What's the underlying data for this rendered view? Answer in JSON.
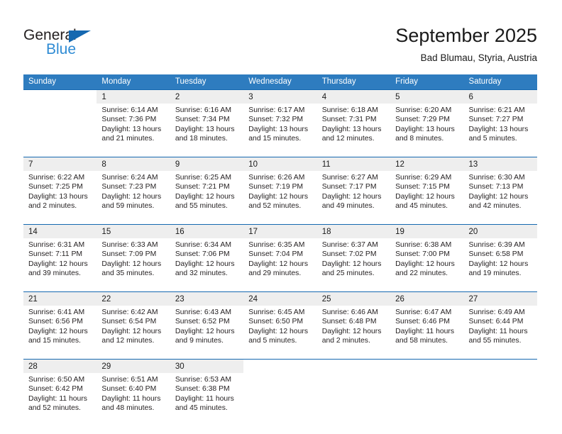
{
  "brand": {
    "name_part1": "General",
    "name_part2": "Blue",
    "triangle_color": "#1568b0",
    "blue_color": "#2e8bd4"
  },
  "header": {
    "title": "September 2025",
    "subtitle": "Bad Blumau, Styria, Austria"
  },
  "theme": {
    "header_row_bg": "#2e7cbf",
    "day_number_bg": "#eeeeee",
    "row_divider": "#1568b0"
  },
  "calendar": {
    "weekday_headers": [
      "Sunday",
      "Monday",
      "Tuesday",
      "Wednesday",
      "Thursday",
      "Friday",
      "Saturday"
    ],
    "weeks": [
      {
        "days": [
          {
            "num": "",
            "sunrise": "",
            "sunset": "",
            "daylight1": "",
            "daylight2": ""
          },
          {
            "num": "1",
            "sunrise": "Sunrise: 6:14 AM",
            "sunset": "Sunset: 7:36 PM",
            "daylight1": "Daylight: 13 hours",
            "daylight2": "and 21 minutes."
          },
          {
            "num": "2",
            "sunrise": "Sunrise: 6:16 AM",
            "sunset": "Sunset: 7:34 PM",
            "daylight1": "Daylight: 13 hours",
            "daylight2": "and 18 minutes."
          },
          {
            "num": "3",
            "sunrise": "Sunrise: 6:17 AM",
            "sunset": "Sunset: 7:32 PM",
            "daylight1": "Daylight: 13 hours",
            "daylight2": "and 15 minutes."
          },
          {
            "num": "4",
            "sunrise": "Sunrise: 6:18 AM",
            "sunset": "Sunset: 7:31 PM",
            "daylight1": "Daylight: 13 hours",
            "daylight2": "and 12 minutes."
          },
          {
            "num": "5",
            "sunrise": "Sunrise: 6:20 AM",
            "sunset": "Sunset: 7:29 PM",
            "daylight1": "Daylight: 13 hours",
            "daylight2": "and 8 minutes."
          },
          {
            "num": "6",
            "sunrise": "Sunrise: 6:21 AM",
            "sunset": "Sunset: 7:27 PM",
            "daylight1": "Daylight: 13 hours",
            "daylight2": "and 5 minutes."
          }
        ]
      },
      {
        "days": [
          {
            "num": "7",
            "sunrise": "Sunrise: 6:22 AM",
            "sunset": "Sunset: 7:25 PM",
            "daylight1": "Daylight: 13 hours",
            "daylight2": "and 2 minutes."
          },
          {
            "num": "8",
            "sunrise": "Sunrise: 6:24 AM",
            "sunset": "Sunset: 7:23 PM",
            "daylight1": "Daylight: 12 hours",
            "daylight2": "and 59 minutes."
          },
          {
            "num": "9",
            "sunrise": "Sunrise: 6:25 AM",
            "sunset": "Sunset: 7:21 PM",
            "daylight1": "Daylight: 12 hours",
            "daylight2": "and 55 minutes."
          },
          {
            "num": "10",
            "sunrise": "Sunrise: 6:26 AM",
            "sunset": "Sunset: 7:19 PM",
            "daylight1": "Daylight: 12 hours",
            "daylight2": "and 52 minutes."
          },
          {
            "num": "11",
            "sunrise": "Sunrise: 6:27 AM",
            "sunset": "Sunset: 7:17 PM",
            "daylight1": "Daylight: 12 hours",
            "daylight2": "and 49 minutes."
          },
          {
            "num": "12",
            "sunrise": "Sunrise: 6:29 AM",
            "sunset": "Sunset: 7:15 PM",
            "daylight1": "Daylight: 12 hours",
            "daylight2": "and 45 minutes."
          },
          {
            "num": "13",
            "sunrise": "Sunrise: 6:30 AM",
            "sunset": "Sunset: 7:13 PM",
            "daylight1": "Daylight: 12 hours",
            "daylight2": "and 42 minutes."
          }
        ]
      },
      {
        "days": [
          {
            "num": "14",
            "sunrise": "Sunrise: 6:31 AM",
            "sunset": "Sunset: 7:11 PM",
            "daylight1": "Daylight: 12 hours",
            "daylight2": "and 39 minutes."
          },
          {
            "num": "15",
            "sunrise": "Sunrise: 6:33 AM",
            "sunset": "Sunset: 7:09 PM",
            "daylight1": "Daylight: 12 hours",
            "daylight2": "and 35 minutes."
          },
          {
            "num": "16",
            "sunrise": "Sunrise: 6:34 AM",
            "sunset": "Sunset: 7:06 PM",
            "daylight1": "Daylight: 12 hours",
            "daylight2": "and 32 minutes."
          },
          {
            "num": "17",
            "sunrise": "Sunrise: 6:35 AM",
            "sunset": "Sunset: 7:04 PM",
            "daylight1": "Daylight: 12 hours",
            "daylight2": "and 29 minutes."
          },
          {
            "num": "18",
            "sunrise": "Sunrise: 6:37 AM",
            "sunset": "Sunset: 7:02 PM",
            "daylight1": "Daylight: 12 hours",
            "daylight2": "and 25 minutes."
          },
          {
            "num": "19",
            "sunrise": "Sunrise: 6:38 AM",
            "sunset": "Sunset: 7:00 PM",
            "daylight1": "Daylight: 12 hours",
            "daylight2": "and 22 minutes."
          },
          {
            "num": "20",
            "sunrise": "Sunrise: 6:39 AM",
            "sunset": "Sunset: 6:58 PM",
            "daylight1": "Daylight: 12 hours",
            "daylight2": "and 19 minutes."
          }
        ]
      },
      {
        "days": [
          {
            "num": "21",
            "sunrise": "Sunrise: 6:41 AM",
            "sunset": "Sunset: 6:56 PM",
            "daylight1": "Daylight: 12 hours",
            "daylight2": "and 15 minutes."
          },
          {
            "num": "22",
            "sunrise": "Sunrise: 6:42 AM",
            "sunset": "Sunset: 6:54 PM",
            "daylight1": "Daylight: 12 hours",
            "daylight2": "and 12 minutes."
          },
          {
            "num": "23",
            "sunrise": "Sunrise: 6:43 AM",
            "sunset": "Sunset: 6:52 PM",
            "daylight1": "Daylight: 12 hours",
            "daylight2": "and 9 minutes."
          },
          {
            "num": "24",
            "sunrise": "Sunrise: 6:45 AM",
            "sunset": "Sunset: 6:50 PM",
            "daylight1": "Daylight: 12 hours",
            "daylight2": "and 5 minutes."
          },
          {
            "num": "25",
            "sunrise": "Sunrise: 6:46 AM",
            "sunset": "Sunset: 6:48 PM",
            "daylight1": "Daylight: 12 hours",
            "daylight2": "and 2 minutes."
          },
          {
            "num": "26",
            "sunrise": "Sunrise: 6:47 AM",
            "sunset": "Sunset: 6:46 PM",
            "daylight1": "Daylight: 11 hours",
            "daylight2": "and 58 minutes."
          },
          {
            "num": "27",
            "sunrise": "Sunrise: 6:49 AM",
            "sunset": "Sunset: 6:44 PM",
            "daylight1": "Daylight: 11 hours",
            "daylight2": "and 55 minutes."
          }
        ]
      },
      {
        "days": [
          {
            "num": "28",
            "sunrise": "Sunrise: 6:50 AM",
            "sunset": "Sunset: 6:42 PM",
            "daylight1": "Daylight: 11 hours",
            "daylight2": "and 52 minutes."
          },
          {
            "num": "29",
            "sunrise": "Sunrise: 6:51 AM",
            "sunset": "Sunset: 6:40 PM",
            "daylight1": "Daylight: 11 hours",
            "daylight2": "and 48 minutes."
          },
          {
            "num": "30",
            "sunrise": "Sunrise: 6:53 AM",
            "sunset": "Sunset: 6:38 PM",
            "daylight1": "Daylight: 11 hours",
            "daylight2": "and 45 minutes."
          },
          {
            "num": "",
            "sunrise": "",
            "sunset": "",
            "daylight1": "",
            "daylight2": ""
          },
          {
            "num": "",
            "sunrise": "",
            "sunset": "",
            "daylight1": "",
            "daylight2": ""
          },
          {
            "num": "",
            "sunrise": "",
            "sunset": "",
            "daylight1": "",
            "daylight2": ""
          },
          {
            "num": "",
            "sunrise": "",
            "sunset": "",
            "daylight1": "",
            "daylight2": ""
          }
        ]
      }
    ]
  }
}
